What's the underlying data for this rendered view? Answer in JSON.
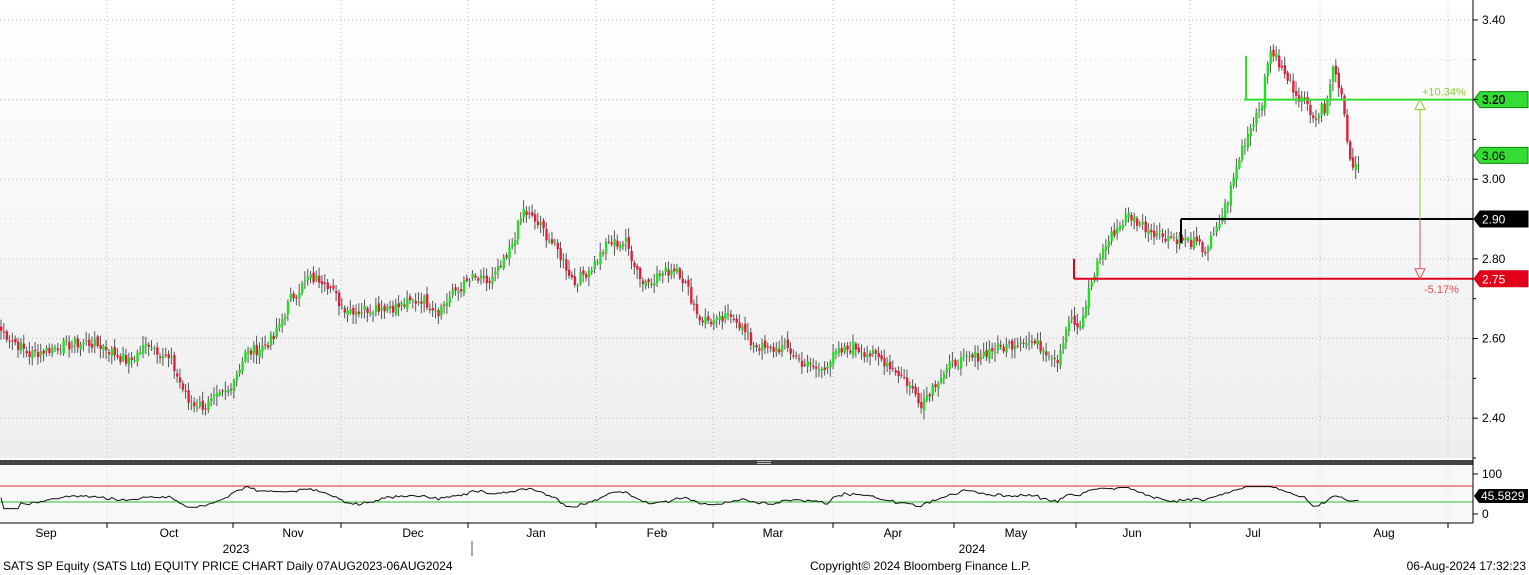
{
  "chart_data": {
    "type": "candlestick",
    "title": "SATS SP Equity (SATS Ltd) EQUITY PRICE CHART",
    "frequency": "Daily",
    "range_text": "Daily 07AUG2023-06AUG2024",
    "ylim": [
      2.3,
      3.45
    ],
    "y_ticks": [
      "3.40",
      "3.20",
      "3.00",
      "2.80",
      "2.60",
      "2.40"
    ],
    "months": [
      "Sep",
      "Oct",
      "Nov",
      "Dec",
      "Jan",
      "Feb",
      "Mar",
      "Apr",
      "May",
      "Jun",
      "Jul",
      "Aug"
    ],
    "years": [
      "2023",
      "2024"
    ],
    "grid": true,
    "colors": {
      "up": "#22dd22",
      "down": "#e0203a",
      "wick": "#555555"
    },
    "anchor_points": [
      [
        0,
        2.62
      ],
      [
        10,
        2.56
      ],
      [
        20,
        2.58
      ],
      [
        30,
        2.59
      ],
      [
        36,
        2.58
      ],
      [
        45,
        2.54
      ],
      [
        52,
        2.59
      ],
      [
        60,
        2.54
      ],
      [
        66,
        2.44
      ],
      [
        72,
        2.43
      ],
      [
        80,
        2.47
      ],
      [
        86,
        2.56
      ],
      [
        92,
        2.58
      ],
      [
        96,
        2.6
      ],
      [
        102,
        2.7
      ],
      [
        108,
        2.75
      ],
      [
        114,
        2.75
      ],
      [
        120,
        2.68
      ],
      [
        126,
        2.67
      ],
      [
        132,
        2.68
      ],
      [
        140,
        2.68
      ],
      [
        148,
        2.7
      ],
      [
        154,
        2.67
      ],
      [
        160,
        2.72
      ],
      [
        166,
        2.75
      ],
      [
        172,
        2.74
      ],
      [
        178,
        2.8
      ],
      [
        184,
        2.92
      ],
      [
        190,
        2.88
      ],
      [
        196,
        2.82
      ],
      [
        202,
        2.74
      ],
      [
        208,
        2.78
      ],
      [
        214,
        2.84
      ],
      [
        220,
        2.84
      ],
      [
        226,
        2.74
      ],
      [
        232,
        2.76
      ],
      [
        238,
        2.78
      ],
      [
        242,
        2.72
      ],
      [
        246,
        2.65
      ],
      [
        252,
        2.64
      ],
      [
        258,
        2.66
      ],
      [
        264,
        2.59
      ],
      [
        270,
        2.57
      ],
      [
        276,
        2.58
      ],
      [
        282,
        2.54
      ],
      [
        288,
        2.52
      ],
      [
        294,
        2.56
      ],
      [
        300,
        2.58
      ],
      [
        306,
        2.56
      ],
      [
        312,
        2.54
      ],
      [
        318,
        2.5
      ],
      [
        324,
        2.44
      ],
      [
        330,
        2.5
      ],
      [
        336,
        2.54
      ],
      [
        342,
        2.55
      ],
      [
        348,
        2.57
      ],
      [
        354,
        2.58
      ],
      [
        360,
        2.6
      ],
      [
        366,
        2.58
      ],
      [
        372,
        2.55
      ],
      [
        376,
        2.65
      ],
      [
        380,
        2.62
      ],
      [
        383,
        2.72
      ],
      [
        387,
        2.81
      ],
      [
        392,
        2.87
      ],
      [
        397,
        2.91
      ],
      [
        403,
        2.88
      ],
      [
        409,
        2.86
      ],
      [
        415,
        2.85
      ],
      [
        420,
        2.84
      ],
      [
        424,
        2.82
      ],
      [
        428,
        2.87
      ],
      [
        432,
        2.95
      ],
      [
        437,
        3.08
      ],
      [
        441,
        3.15
      ],
      [
        444,
        3.2
      ],
      [
        447,
        3.33
      ],
      [
        452,
        3.26
      ],
      [
        458,
        3.2
      ],
      [
        463,
        3.16
      ],
      [
        466,
        3.18
      ],
      [
        469,
        3.28
      ],
      [
        472,
        3.22
      ],
      [
        475,
        3.05
      ],
      [
        478,
        3.03
      ]
    ],
    "annotations": {
      "levels": [
        {
          "value_label": "3.20",
          "color": "#33dd33",
          "text_color": "#000000"
        },
        {
          "value_label": "3.06",
          "color": "#33dd33",
          "text_color": "#000000"
        },
        {
          "value_label": "2.90",
          "color": "#000000",
          "text_color": "#ffffff"
        },
        {
          "value_label": "2.75",
          "color": "#e0001a",
          "text_color": "#ffffff"
        }
      ],
      "up_move_label": "+10.34%",
      "down_move_label": "-5.17%"
    },
    "rsi": {
      "y_ticks": [
        "100",
        "0"
      ],
      "upper_band": 70,
      "lower_band": 30,
      "last_value": "45.5829"
    }
  },
  "footer": {
    "left": "SATS SP Equity (SATS Ltd) EQUITY PRICE CHART  Daily 07AUG2023-06AUG2024",
    "center": "Copyright© 2024 Bloomberg Finance L.P.",
    "right": "06-Aug-2024 17:32:23"
  }
}
